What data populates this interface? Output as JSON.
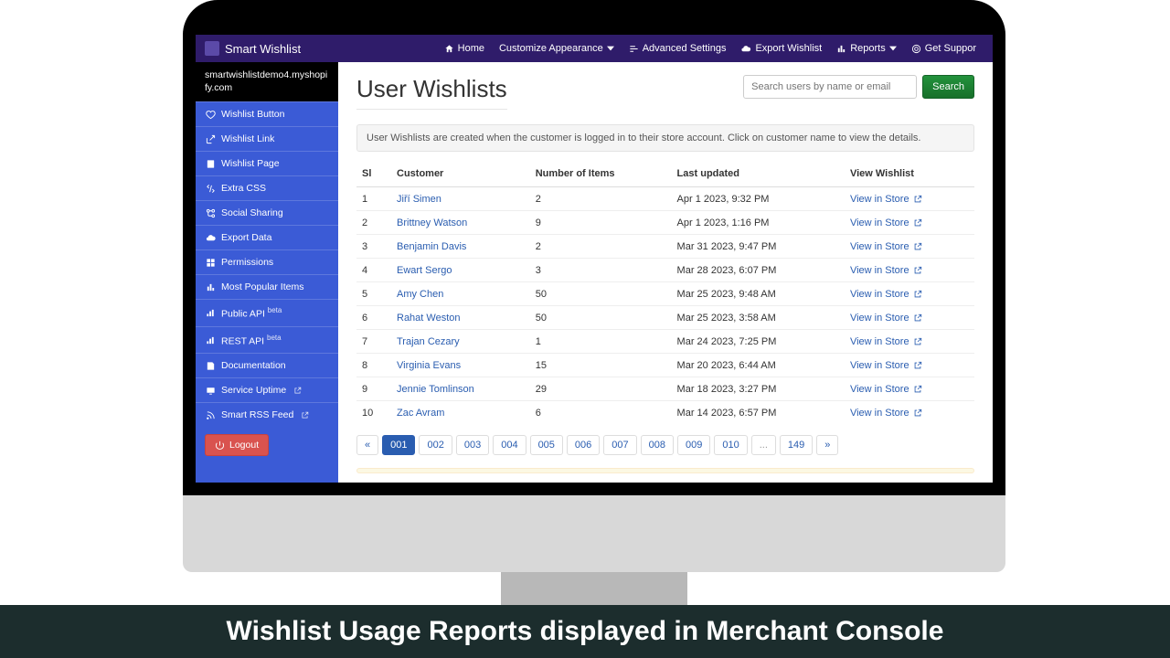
{
  "caption": "Wishlist Usage Reports displayed in Merchant Console",
  "brand": {
    "name": "Smart Wishlist"
  },
  "topnav": {
    "home": "Home",
    "customize": "Customize Appearance",
    "advanced": "Advanced Settings",
    "export": "Export Wishlist",
    "reports": "Reports",
    "support": "Get Suppor"
  },
  "sidebar": {
    "domain": "smartwishlistdemo4.myshopify.com",
    "items": [
      {
        "label": "Wishlist Button"
      },
      {
        "label": "Wishlist Link"
      },
      {
        "label": "Wishlist Page"
      },
      {
        "label": "Extra CSS"
      },
      {
        "label": "Social Sharing"
      },
      {
        "label": "Export Data"
      },
      {
        "label": "Permissions"
      },
      {
        "label": "Most Popular Items"
      },
      {
        "label": "Public API",
        "beta": "beta"
      },
      {
        "label": "REST API",
        "beta": "beta"
      },
      {
        "label": "Documentation"
      },
      {
        "label": "Service Uptime",
        "ext": true
      },
      {
        "label": "Smart RSS Feed",
        "ext": true
      }
    ],
    "logout": "Logout"
  },
  "main": {
    "title": "User Wishlists",
    "search_placeholder": "Search users by name or email",
    "search_btn": "Search",
    "info": "User Wishlists are created when the customer is logged in to their store account. Click on customer name to view the details.",
    "columns": {
      "sl": "Sl",
      "customer": "Customer",
      "items": "Number of Items",
      "updated": "Last updated",
      "view": "View Wishlist"
    },
    "view_label": "View in Store",
    "rows": [
      {
        "sl": "1",
        "customer": "Jiří Simen",
        "items": "2",
        "updated": "Apr 1 2023, 9:32 PM"
      },
      {
        "sl": "2",
        "customer": "Brittney Watson",
        "items": "9",
        "updated": "Apr 1 2023, 1:16 PM"
      },
      {
        "sl": "3",
        "customer": "Benjamin Davis",
        "items": "2",
        "updated": "Mar 31 2023, 9:47 PM"
      },
      {
        "sl": "4",
        "customer": "Ewart Sergo",
        "items": "3",
        "updated": "Mar 28 2023, 6:07 PM"
      },
      {
        "sl": "5",
        "customer": "Amy Chen",
        "items": "50",
        "updated": "Mar 25 2023, 9:48 AM"
      },
      {
        "sl": "6",
        "customer": "Rahat Weston",
        "items": "50",
        "updated": "Mar 25 2023, 3:58 AM"
      },
      {
        "sl": "7",
        "customer": "Trajan Cezary",
        "items": "1",
        "updated": "Mar 24 2023, 7:25 PM"
      },
      {
        "sl": "8",
        "customer": "Virginia Evans",
        "items": "15",
        "updated": "Mar 20 2023, 6:44 AM"
      },
      {
        "sl": "9",
        "customer": "Jennie Tomlinson",
        "items": "29",
        "updated": "Mar 18 2023, 3:27 PM"
      },
      {
        "sl": "10",
        "customer": "Zac Avram",
        "items": "6",
        "updated": "Mar 14 2023, 6:57 PM"
      }
    ],
    "pagination": {
      "prev": "«",
      "pages": [
        "001",
        "002",
        "003",
        "004",
        "005",
        "006",
        "007",
        "008",
        "009",
        "010"
      ],
      "ellipsis": "...",
      "last": "149",
      "next": "»",
      "active": "001"
    }
  }
}
